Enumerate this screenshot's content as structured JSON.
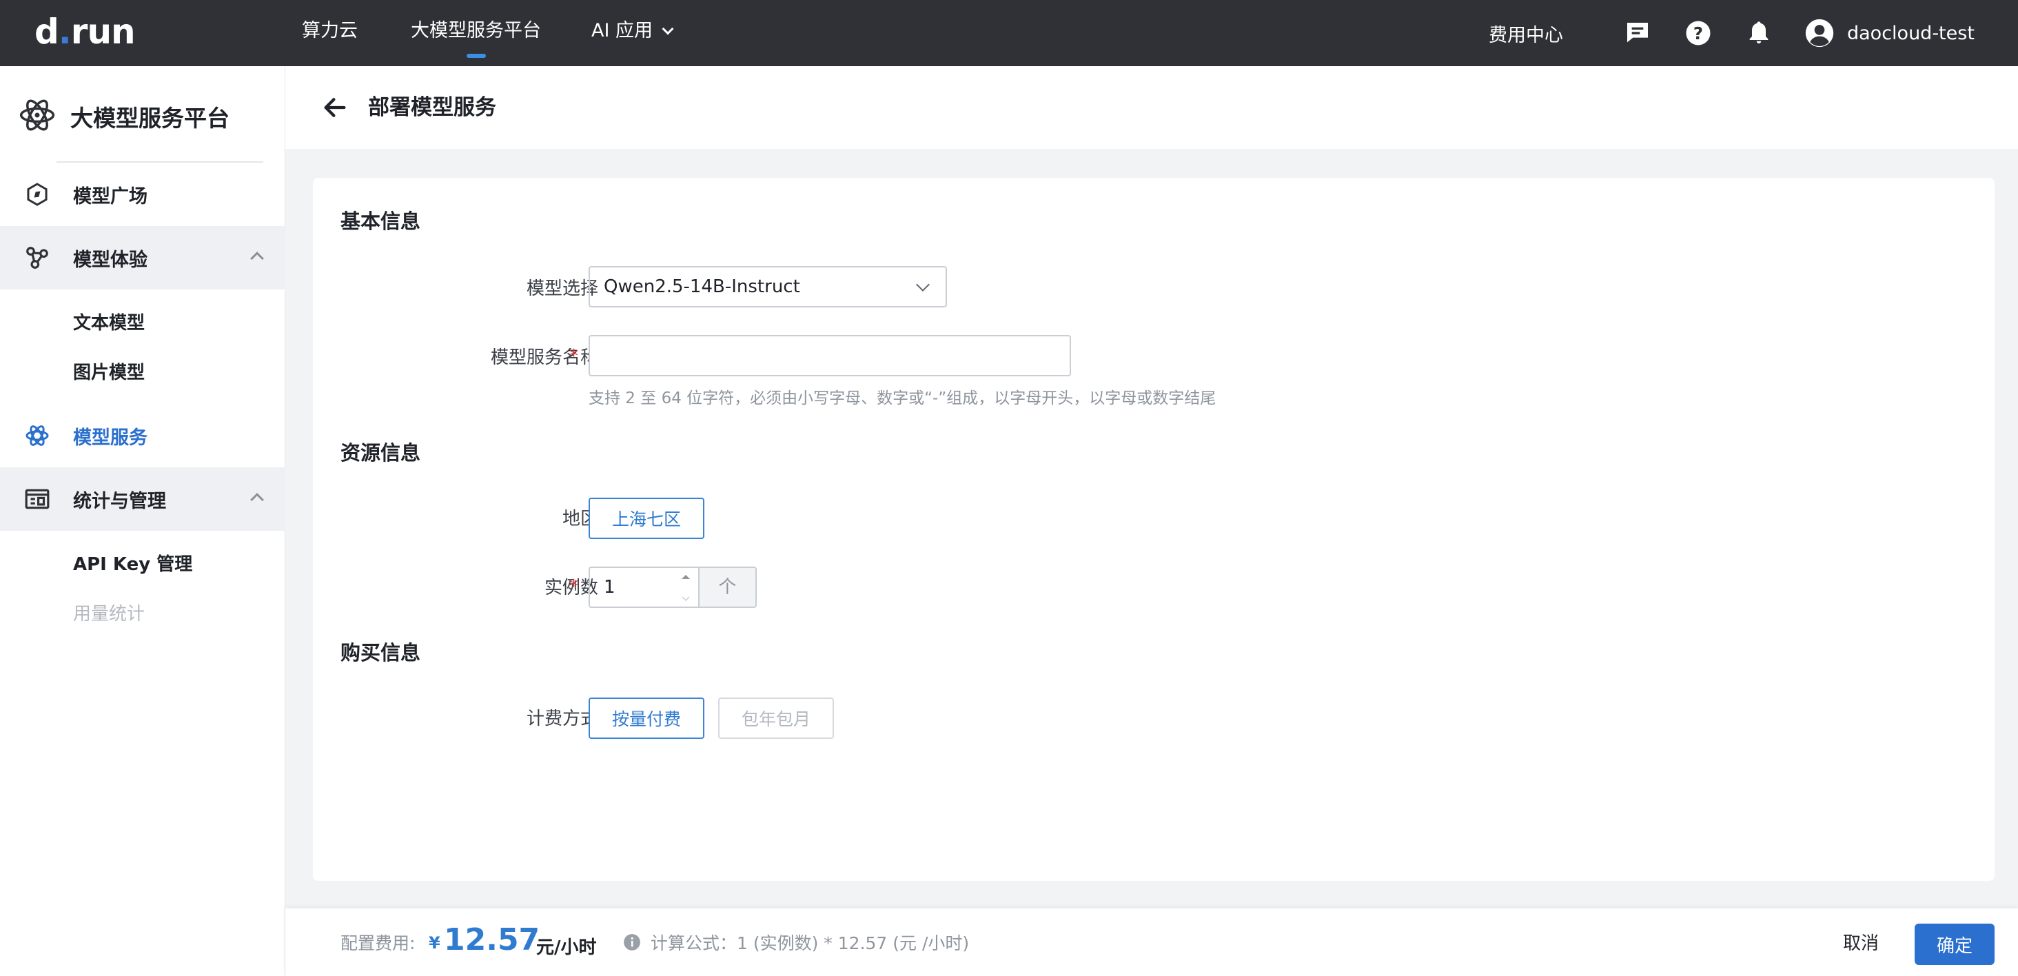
{
  "topbar": {
    "logo": {
      "part1": "d",
      "dot": ".",
      "part2": "run"
    },
    "nav": [
      {
        "label": "算力云"
      },
      {
        "label": "大模型服务平台"
      },
      {
        "label": "AI 应用"
      }
    ],
    "billing": "费用中心",
    "username": "daocloud-test",
    "icons": [
      "message-icon",
      "help-icon",
      "bell-icon",
      "user-avatar-icon"
    ]
  },
  "sidebar": {
    "title": "大模型服务平台",
    "items": [
      {
        "label": "模型广场"
      },
      {
        "label": "模型体验"
      },
      {
        "label": "文本模型"
      },
      {
        "label": "图片模型"
      },
      {
        "label": "模型服务"
      },
      {
        "label": "统计与管理"
      },
      {
        "label": "API Key 管理"
      },
      {
        "label": "用量统计"
      }
    ]
  },
  "header": {
    "title": "部署模型服务"
  },
  "form": {
    "basic_title": "基本信息",
    "model_label": "模型选择",
    "model_value": "Qwen2.5-14B-Instruct",
    "name_label": "模型服务名称",
    "name_value": "",
    "name_hint": "支持 2 至 64 位字符，必须由小写字母、数字或“-”组成，以字母开头，以字母或数字结尾",
    "resource_title": "资源信息",
    "region_label": "地区",
    "region_value": "上海七区",
    "instances_label": "实例数",
    "instances_value": "1",
    "instances_unit": "个",
    "purchase_title": "购买信息",
    "billing_label": "计费方式",
    "billing_options": [
      "按量付费",
      "包年包月"
    ],
    "required_mark": "*"
  },
  "footer": {
    "cost_label": "配置费用:",
    "currency": "¥",
    "price": "12.57",
    "price_unit": "元/小时",
    "formula": "计算公式：1 (实例数) * 12.57 (元 /小时)",
    "cancel": "取消",
    "confirm": "确定"
  },
  "colors": {
    "accent": "#2b6fcf",
    "topbar": "#2f3136",
    "required": "#e03535"
  }
}
